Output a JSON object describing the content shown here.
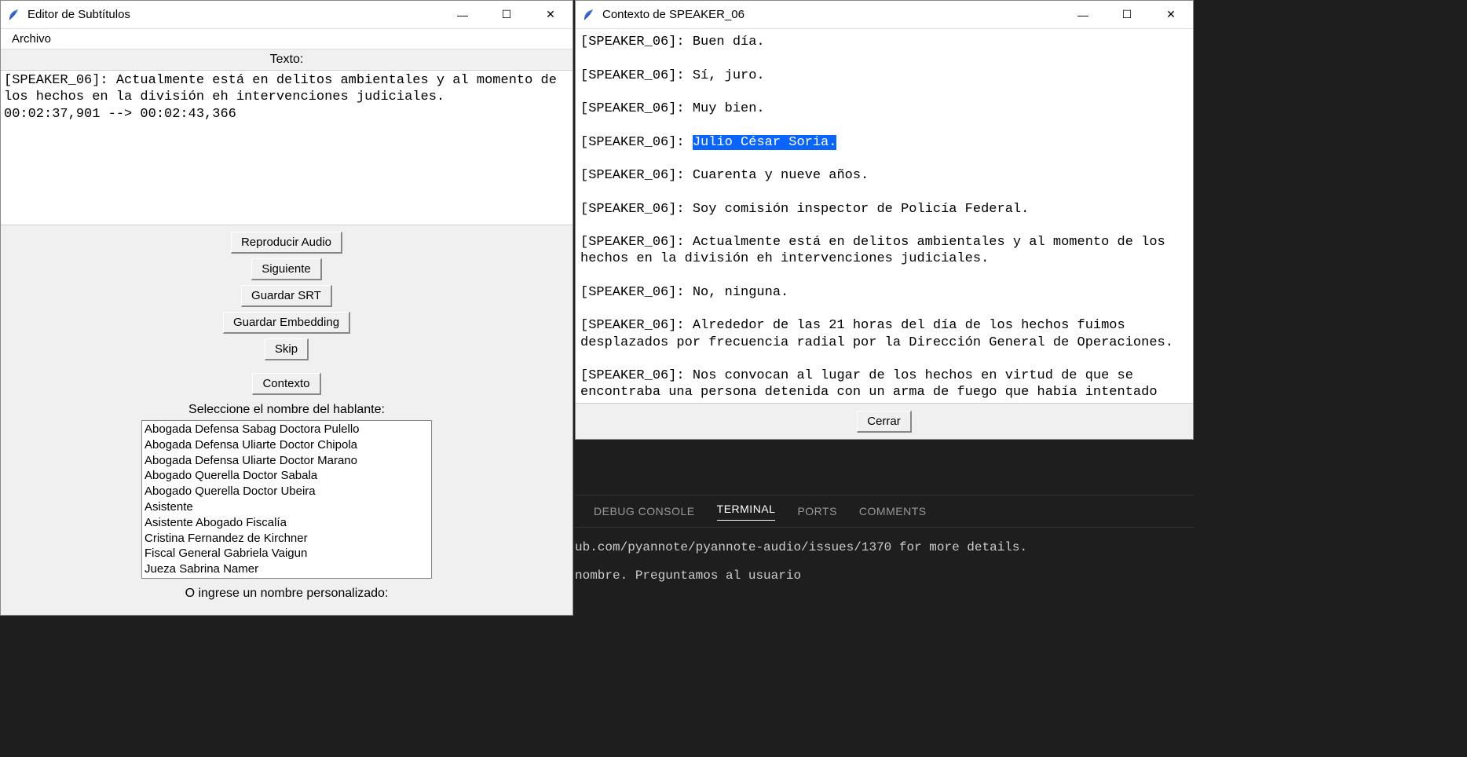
{
  "editor": {
    "title": "Editor de Subtítulos",
    "menu_file": "Archivo",
    "label_text": "Texto:",
    "text_content": "[SPEAKER_06]: Actualmente está en delitos ambientales y al momento de los hechos en la división eh intervenciones judiciales.\n00:02:37,901 --> 00:02:43,366",
    "buttons": {
      "play": "Reproducir Audio",
      "next": "Siguiente",
      "save_srt": "Guardar SRT",
      "save_emb": "Guardar Embedding",
      "skip": "Skip",
      "context": "Contexto"
    },
    "label_select_speaker": "Seleccione el nombre del hablante:",
    "speakers": [
      "Abogada Defensa Sabag Doctora Pulello",
      "Abogada Defensa Uliarte Doctor Chipola",
      "Abogada Defensa Uliarte Doctor Marano",
      "Abogado Querella Doctor Sabala",
      "Abogado Querella Doctor Ubeira",
      "Asistente",
      "Asistente Abogado Fiscalía",
      "Cristina Fernandez de Kirchner",
      "Fiscal General Gabriela Vaigun",
      "Jueza Sabrina Namer"
    ],
    "label_custom": "O ingrese un nombre personalizado:"
  },
  "context": {
    "title": "Contexto de SPEAKER_06",
    "lines_before": "[SPEAKER_06]: Buen día.\n\n[SPEAKER_06]: Sí, juro.\n\n[SPEAKER_06]: Muy bien.\n\n[SPEAKER_06]: ",
    "highlight": "Julio César Soria.",
    "lines_after": "\n\n[SPEAKER_06]: Cuarenta y nueve años.\n\n[SPEAKER_06]: Soy comisión inspector de Policía Federal.\n\n[SPEAKER_06]: Actualmente está en delitos ambientales y al momento de los hechos en la división eh intervenciones judiciales.\n\n[SPEAKER_06]: No, ninguna.\n\n[SPEAKER_06]: Alrededor de las 21 horas del día de los hechos fuimos desplazados por frecuencia radial por la Dirección General de Operaciones.\n\n[SPEAKER_06]: Nos convocan al lugar de los hechos en virtud de que se encontraba una persona detenida con un arma de fuego que había intentado perpetrar un ilícito.",
    "close": "Cerrar"
  },
  "vscode": {
    "tabs": {
      "debug": "DEBUG CONSOLE",
      "terminal": "TERMINAL",
      "ports": "PORTS",
      "comments": "COMMENTS"
    },
    "term_line1": "ub.com/pyannote/pyannote-audio/issues/1370 for more details.",
    "term_line2": "nombre. Preguntamos al usuario"
  },
  "winctl": {
    "min": "—",
    "max": "☐",
    "close": "✕"
  }
}
